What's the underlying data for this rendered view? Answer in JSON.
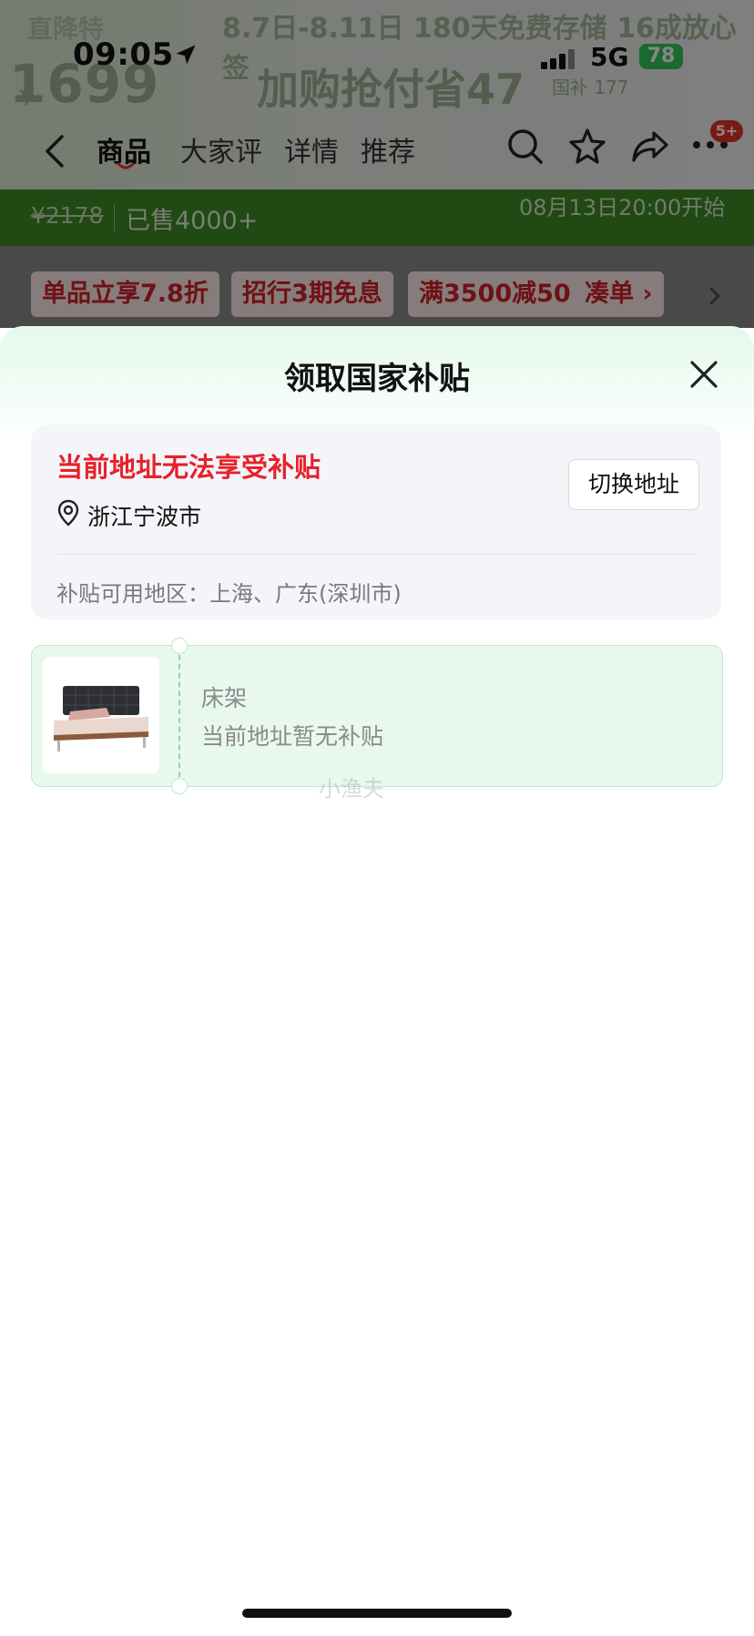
{
  "status_bar": {
    "time": "09:05",
    "network": "5G",
    "battery": "78"
  },
  "background_promo": {
    "tag": "直降特",
    "ribbon": "8.7日-8.11日 180天免费存储 16成放心签",
    "price": "1699",
    "currency": "￥",
    "pay_text": "加购抢付省47",
    "tip": "国补 177"
  },
  "nav": {
    "tabs": [
      "商品",
      "大家评",
      "详情",
      "推荐"
    ],
    "cart_badge": "5+"
  },
  "price_bar": {
    "original_price": "¥2178",
    "sold": "已售4000+",
    "start_time": "08月13日20:00开始"
  },
  "coupons": [
    {
      "label": "单品立享7.8折"
    },
    {
      "label": "招行3期免息"
    },
    {
      "label": "满3500减50"
    },
    {
      "label": "凑单 ›"
    }
  ],
  "sheet": {
    "title": "领取国家补贴",
    "address_card": {
      "warning": "当前地址无法享受补贴",
      "city": "浙江宁波市",
      "switch_button": "切换地址",
      "eligible_regions": "补贴可用地区：上海、广东(深圳市)"
    },
    "item": {
      "name": "床架",
      "status": "当前地址暂无补贴"
    },
    "watermark": "小渔夫"
  }
}
